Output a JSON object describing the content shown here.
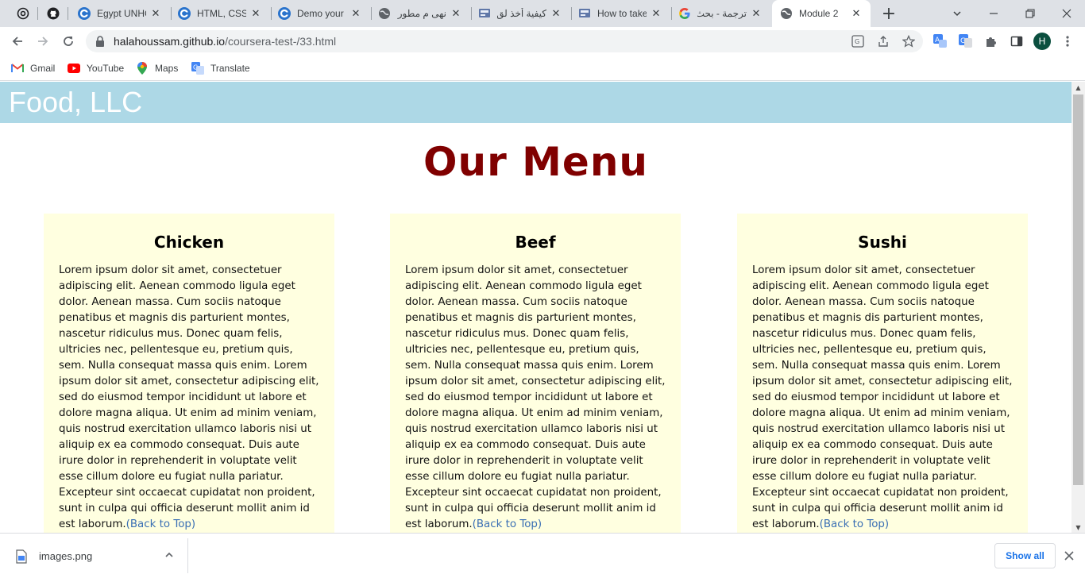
{
  "browser": {
    "tabs": [
      {
        "title": "",
        "icon": "openai-icon",
        "pinned": true
      },
      {
        "title": "",
        "icon": "github-icon",
        "pinned": true
      },
      {
        "title": "Egypt UNHC",
        "icon": "coursera-icon"
      },
      {
        "title": "HTML, CSS,",
        "icon": "coursera-icon"
      },
      {
        "title": "Demo your",
        "icon": "coursera-icon"
      },
      {
        "title": "نهى م مطور",
        "icon": "globe-icon"
      },
      {
        "title": "كيفية أخذ لق",
        "icon": "page-icon"
      },
      {
        "title": "How to take",
        "icon": "page-icon"
      },
      {
        "title": "ترجمة - بحث",
        "icon": "google-icon"
      },
      {
        "title": "Module 2",
        "icon": "globe-icon",
        "active": true
      }
    ],
    "new_tab_label": "+",
    "url_host": "halahoussam.github.io",
    "url_path": "/coursera-test-/33.html",
    "profile_initial": "H",
    "bookmarks": [
      {
        "label": "Gmail",
        "icon": "gmail-icon"
      },
      {
        "label": "YouTube",
        "icon": "youtube-icon"
      },
      {
        "label": "Maps",
        "icon": "maps-icon"
      },
      {
        "label": "Translate",
        "icon": "translate-icon"
      }
    ]
  },
  "page": {
    "brand": "Food, LLC",
    "heading": "Our Menu",
    "cards": [
      {
        "title": "Chicken",
        "body": "Lorem ipsum dolor sit amet, consectetuer adipiscing elit. Aenean commodo ligula eget dolor. Aenean massa. Cum sociis natoque penatibus et magnis dis parturient montes, nascetur ridiculus mus. Donec quam felis, ultricies nec, pellentesque eu, pretium quis, sem. Nulla consequat massa quis enim. Lorem ipsum dolor sit amet, consectetur adipiscing elit, sed do eiusmod tempor incididunt ut labore et dolore magna aliqua. Ut enim ad minim veniam, quis nostrud exercitation ullamco laboris nisi ut aliquip ex ea commodo consequat. Duis aute irure dolor in reprehenderit in voluptate velit esse cillum dolore eu fugiat nulla pariatur. Excepteur sint occaecat cupidatat non proident, sunt in culpa qui officia deserunt mollit anim id est laborum.",
        "link": "(Back to Top)"
      },
      {
        "title": "Beef",
        "body": "Lorem ipsum dolor sit amet, consectetuer adipiscing elit. Aenean commodo ligula eget dolor. Aenean massa. Cum sociis natoque penatibus et magnis dis parturient montes, nascetur ridiculus mus. Donec quam felis, ultricies nec, pellentesque eu, pretium quis, sem. Nulla consequat massa quis enim. Lorem ipsum dolor sit amet, consectetur adipiscing elit, sed do eiusmod tempor incididunt ut labore et dolore magna aliqua. Ut enim ad minim veniam, quis nostrud exercitation ullamco laboris nisi ut aliquip ex ea commodo consequat. Duis aute irure dolor in reprehenderit in voluptate velit esse cillum dolore eu fugiat nulla pariatur. Excepteur sint occaecat cupidatat non proident, sunt in culpa qui officia deserunt mollit anim id est laborum.",
        "link": "(Back to Top)"
      },
      {
        "title": "Sushi",
        "body": "Lorem ipsum dolor sit amet, consectetuer adipiscing elit. Aenean commodo ligula eget dolor. Aenean massa. Cum sociis natoque penatibus et magnis dis parturient montes, nascetur ridiculus mus. Donec quam felis, ultricies nec, pellentesque eu, pretium quis, sem. Nulla consequat massa quis enim. Lorem ipsum dolor sit amet, consectetur adipiscing elit, sed do eiusmod tempor incididunt ut labore et dolore magna aliqua. Ut enim ad minim veniam, quis nostrud exercitation ullamco laboris nisi ut aliquip ex ea commodo consequat. Duis aute irure dolor in reprehenderit in voluptate velit esse cillum dolore eu fugiat nulla pariatur. Excepteur sint occaecat cupidatat non proident, sunt in culpa qui officia deserunt mollit anim id est laborum.",
        "link": "(Back to Top)"
      }
    ]
  },
  "downloads": {
    "file_name": "images.png",
    "show_all_label": "Show all"
  },
  "colors": {
    "header_bg": "#add8e6",
    "heading": "#800000",
    "card_bg": "#ffffe0",
    "link": "#3a6fb4"
  }
}
